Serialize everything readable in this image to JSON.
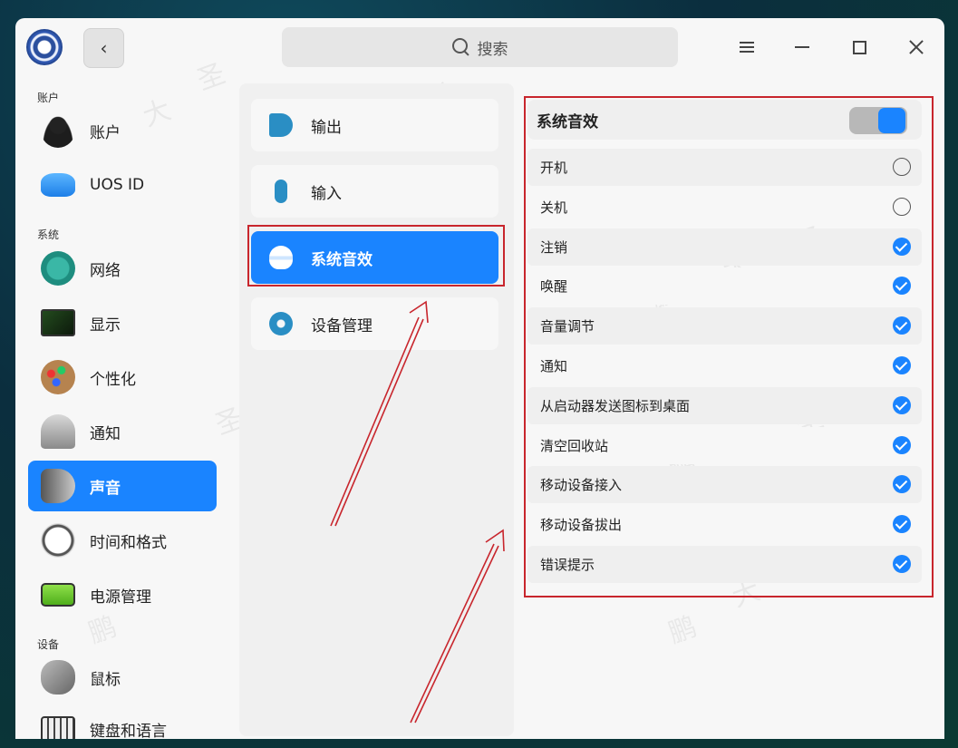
{
  "titlebar": {
    "search_label": "搜索",
    "back_icon": "chevron-left-icon"
  },
  "sidebar": {
    "sections": [
      {
        "label": "账户"
      },
      {
        "label": "系统"
      },
      {
        "label": "设备"
      }
    ],
    "items": [
      {
        "label": "账户",
        "icon": "user-avatar-icon"
      },
      {
        "label": "UOS ID",
        "icon": "cloud-icon"
      },
      {
        "label": "网络",
        "icon": "network-icon"
      },
      {
        "label": "显示",
        "icon": "monitor-icon"
      },
      {
        "label": "个性化",
        "icon": "palette-icon"
      },
      {
        "label": "通知",
        "icon": "bell-icon"
      },
      {
        "label": "声音",
        "icon": "speaker-icon",
        "active": true
      },
      {
        "label": "时间和格式",
        "icon": "clock-icon"
      },
      {
        "label": "电源管理",
        "icon": "battery-icon"
      },
      {
        "label": "鼠标",
        "icon": "mouse-icon"
      },
      {
        "label": "键盘和语言",
        "icon": "keyboard-icon"
      }
    ]
  },
  "sound_menu": {
    "items": [
      {
        "label": "输出",
        "icon": "speaker-output-icon"
      },
      {
        "label": "输入",
        "icon": "microphone-icon"
      },
      {
        "label": "系统音效",
        "icon": "system-sound-icon",
        "active": true
      },
      {
        "label": "设备管理",
        "icon": "gear-icon"
      }
    ]
  },
  "system_sounds": {
    "title": "系统音效",
    "enabled": true,
    "items": [
      {
        "label": "开机",
        "checked": false
      },
      {
        "label": "关机",
        "checked": false
      },
      {
        "label": "注销",
        "checked": true
      },
      {
        "label": "唤醒",
        "checked": true
      },
      {
        "label": "音量调节",
        "checked": true
      },
      {
        "label": "通知",
        "checked": true
      },
      {
        "label": "从启动器发送图标到桌面",
        "checked": true
      },
      {
        "label": "清空回收站",
        "checked": true
      },
      {
        "label": "移动设备接入",
        "checked": true
      },
      {
        "label": "移动设备拔出",
        "checked": true
      },
      {
        "label": "错误提示",
        "checked": true
      }
    ]
  },
  "colors": {
    "accent": "#1a84ff",
    "annotation": "#c8262d"
  }
}
